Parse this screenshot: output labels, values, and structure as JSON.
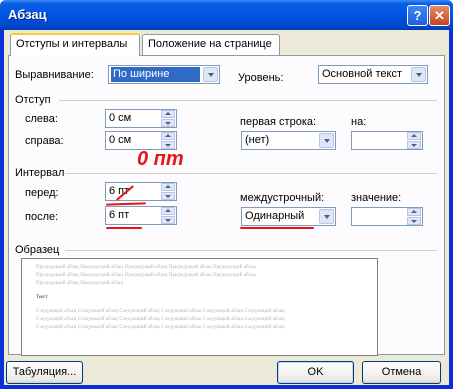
{
  "window": {
    "title": "Абзац",
    "help_button": "?",
    "close_button": "✕"
  },
  "tabs": [
    {
      "label": "Отступы и интервалы"
    },
    {
      "label": "Положение на странице"
    }
  ],
  "general": {
    "alignment_label": "Выравнивание:",
    "alignment_value": "По ширине",
    "level_label": "Уровень:",
    "level_value": "Основной текст"
  },
  "indent": {
    "group_label": "Отступ",
    "left_label": "слева:",
    "left_value": "0 см",
    "right_label": "справа:",
    "right_value": "0 см",
    "first_line_label": "первая строка:",
    "first_line_value": "(нет)",
    "on_label": "на:",
    "on_value": ""
  },
  "spacing": {
    "group_label": "Интервал",
    "before_label": "перед:",
    "before_value": "6 пт",
    "after_label": "после:",
    "after_value": "6 пт",
    "line_spacing_label": "междустрочный:",
    "line_spacing_value": "Одинарный",
    "value_label": "значение:",
    "value_value": ""
  },
  "preview": {
    "group_label": "Образец",
    "prev_lines": [
      "Предыдущий абзац Предыдущий абзац Предыдущий абзац Предыдущий абзац Предыдущий абзац",
      "Предыдущий абзац Предыдущий абзац Предыдущий абзац Предыдущий абзац Предыдущий абзац",
      "Предыдущий абзац Предыдущий абзац"
    ],
    "sample_text": "Текст",
    "next_lines": [
      "Следующий абзац Следующий абзац Следующий абзац Следующий абзац Следующий абзац Следующий абзац",
      "Следующий абзац Следующий абзац Следующий абзац Следующий абзац Следующий абзац Следующий абзац",
      "Следующий абзац Следующий абзац Следующий абзац Следующий абзац Следующий абзац Следующий абзац"
    ]
  },
  "annotation": {
    "text": "0 пт",
    "color": "#e8141a"
  },
  "buttons": {
    "tabs": "Табуляция...",
    "ok": "OK",
    "cancel": "Отмена"
  },
  "colors": {
    "titlebar": "#0054e3",
    "dialog_bg": "#ece9d8",
    "selection": "#316ac5"
  }
}
